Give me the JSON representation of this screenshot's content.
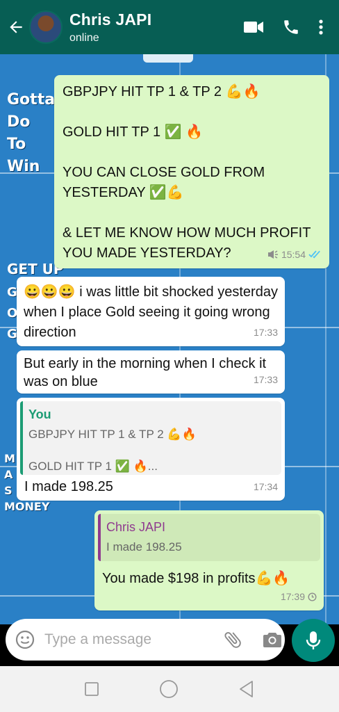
{
  "header": {
    "contact_name": "Chris JAPI",
    "status": "online"
  },
  "wallpaper": {
    "text_1": "Gotta\nDo\nTo\nWin",
    "text_2": "GET UP",
    "text_3": "G\nO\nG",
    "text_4": "M\nA\nS\nMONEY"
  },
  "messages": [
    {
      "direction": "outgoing",
      "text": "GBPJPY HIT TP 1 & TP 2 💪🔥\n\nGOLD HIT TP 1 ✅ 🔥\n\nYOU CAN CLOSE GOLD FROM YESTERDAY ✅💪\n\n& LET ME KNOW HOW MUCH PROFIT YOU MADE YESTERDAY?",
      "time": "15:54"
    },
    {
      "direction": "incoming",
      "text": "😀😀😀 i was little bit shocked yesterday when I place Gold seeing it going wrong direction",
      "time": "17:33"
    },
    {
      "direction": "incoming",
      "text": "But early in the morning when I check it was on blue",
      "time": "17:33"
    },
    {
      "direction": "incoming",
      "quote_author": "You",
      "quote_text": "GBPJPY HIT TP 1 & TP 2 💪🔥\n\nGOLD HIT TP 1 ✅ 🔥...",
      "text": "I made 198.25",
      "time": "17:34"
    },
    {
      "direction": "outgoing",
      "quote_author": "Chris JAPI",
      "quote_text": "I made 198.25",
      "text": "You made $198 in profits💪🔥",
      "time": "17:39"
    }
  ],
  "input": {
    "placeholder": "Type a message"
  },
  "colors": {
    "header": "#075e54",
    "outgoing_bubble": "#dcf8c6",
    "incoming_bubble": "#ffffff",
    "wallpaper": "#2a80c6",
    "read_ticks": "#4fc3f7",
    "mic_button": "#00897b"
  },
  "icons": [
    "back-arrow-icon",
    "video-call-icon",
    "phone-icon",
    "more-options-icon",
    "emoji-icon",
    "attach-icon",
    "camera-icon",
    "mic-icon",
    "nav-recents-icon",
    "nav-home-icon",
    "nav-back-icon",
    "speaker-icon",
    "double-check-icon",
    "clock-icon"
  ]
}
